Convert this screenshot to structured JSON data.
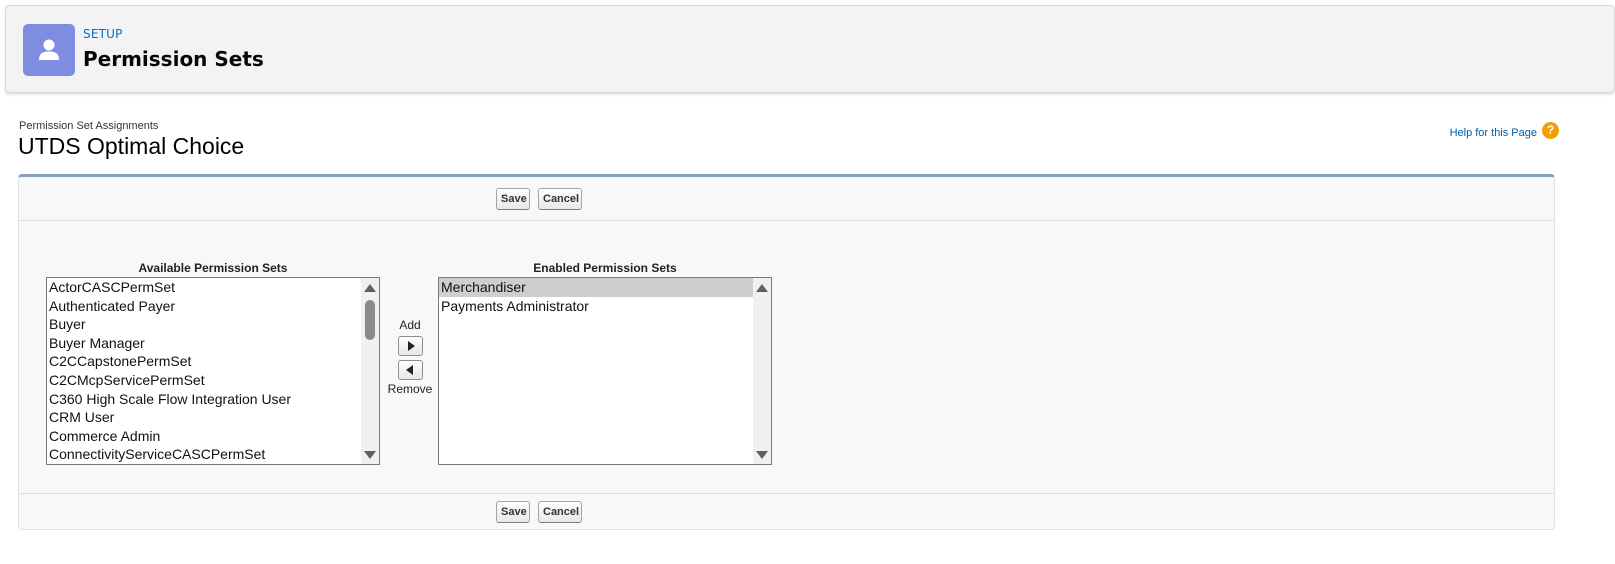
{
  "header": {
    "breadcrumb": "SETUP",
    "title": "Permission Sets",
    "icon": "user-icon",
    "icon_color": "#7f8de1"
  },
  "page": {
    "type_label": "Permission Set Assignments",
    "name": "UTDS Optimal Choice",
    "help_link": "Help for this Page",
    "help_icon": "?"
  },
  "buttons": {
    "save": "Save",
    "cancel": "Cancel"
  },
  "available": {
    "label": "Available Permission Sets",
    "items": [
      "ActorCASCPermSet",
      "Authenticated Payer",
      "Buyer",
      "Buyer Manager",
      "C2CCapstonePermSet",
      "C2CMcpServicePermSet",
      "C360 High Scale Flow Integration User",
      "CRM User",
      "Commerce Admin",
      "ConnectivityServiceCASCPermSet"
    ]
  },
  "enabled": {
    "label": "Enabled Permission Sets",
    "items": [
      "Merchandiser",
      "Payments Administrator"
    ],
    "selected_index": 0
  },
  "move": {
    "add_label": "Add",
    "remove_label": "Remove"
  }
}
